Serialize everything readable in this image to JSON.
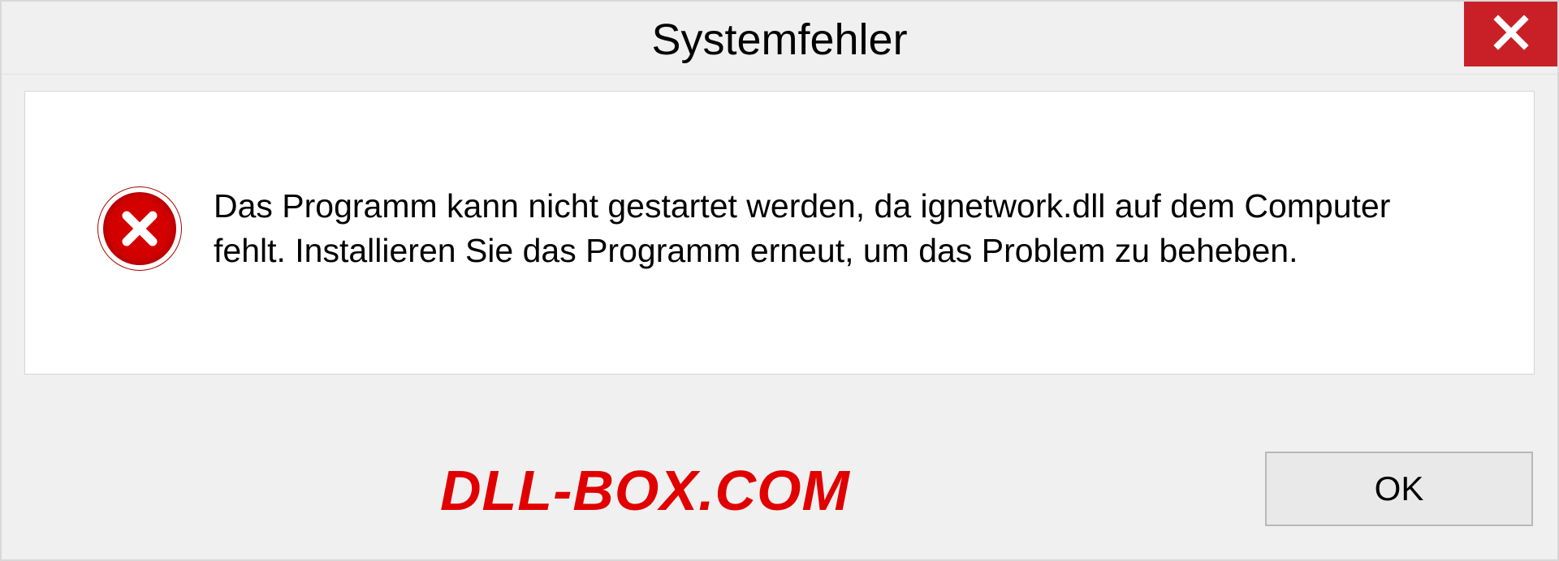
{
  "dialog": {
    "title": "Systemfehler",
    "message": "Das Programm kann nicht gestartet werden, da ignetwork.dll auf dem Computer fehlt. Installieren Sie das Programm erneut, um das Problem zu beheben.",
    "ok_label": "OK"
  },
  "watermark": "DLL-BOX.COM"
}
